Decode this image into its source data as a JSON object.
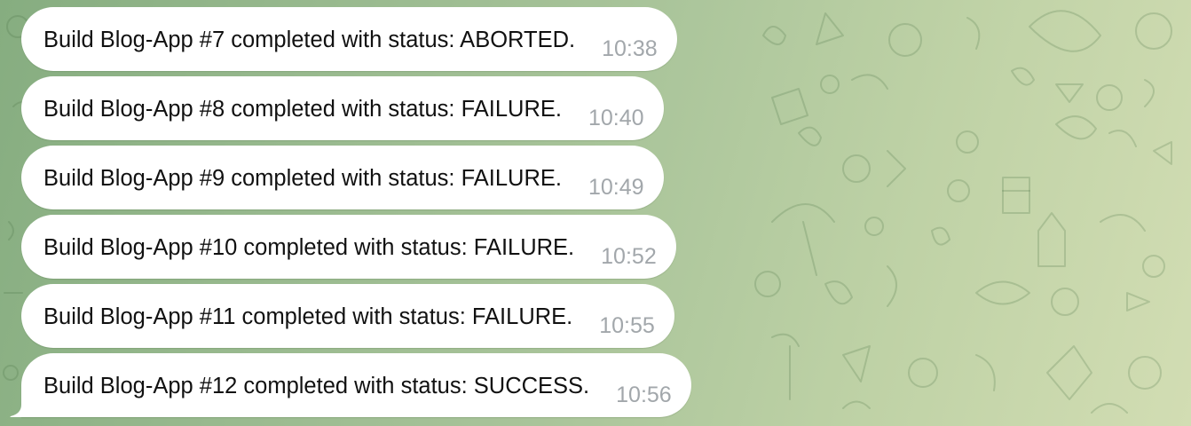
{
  "messages": [
    {
      "text": "Build Blog-App #7 completed with status: ABORTED.",
      "time": "10:38"
    },
    {
      "text": "Build Blog-App #8 completed with status: FAILURE.",
      "time": "10:40"
    },
    {
      "text": "Build Blog-App #9 completed with status: FAILURE.",
      "time": "10:49"
    },
    {
      "text": "Build Blog-App #10 completed with status: FAILURE.",
      "time": "10:52"
    },
    {
      "text": "Build Blog-App #11 completed with status: FAILURE.",
      "time": "10:55"
    },
    {
      "text": "Build Blog-App #12 completed with status: SUCCESS.",
      "time": "10:56"
    }
  ],
  "colors": {
    "bubble": "#ffffff",
    "text": "#111111",
    "timestamp": "#a2a7ab",
    "background_start": "#86ad80",
    "background_end": "#d2ddb3"
  },
  "icons": [
    "doodle-pattern-background",
    "message-tail-icon"
  ]
}
